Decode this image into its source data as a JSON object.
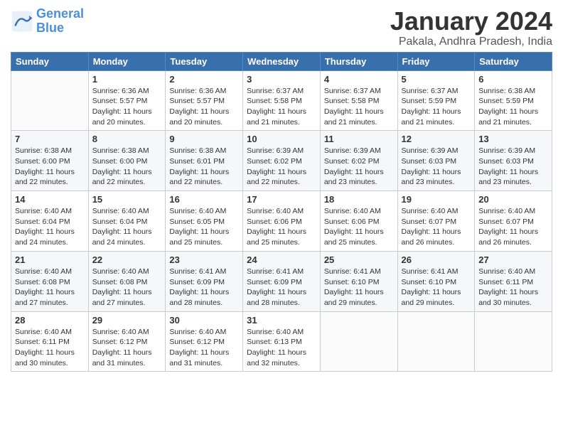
{
  "logo": {
    "text_general": "General",
    "text_blue": "Blue"
  },
  "header": {
    "title": "January 2024",
    "subtitle": "Pakala, Andhra Pradesh, India"
  },
  "weekdays": [
    "Sunday",
    "Monday",
    "Tuesday",
    "Wednesday",
    "Thursday",
    "Friday",
    "Saturday"
  ],
  "weeks": [
    [
      {
        "day": "",
        "info": ""
      },
      {
        "day": "1",
        "info": "Sunrise: 6:36 AM\nSunset: 5:57 PM\nDaylight: 11 hours\nand 20 minutes."
      },
      {
        "day": "2",
        "info": "Sunrise: 6:36 AM\nSunset: 5:57 PM\nDaylight: 11 hours\nand 20 minutes."
      },
      {
        "day": "3",
        "info": "Sunrise: 6:37 AM\nSunset: 5:58 PM\nDaylight: 11 hours\nand 21 minutes."
      },
      {
        "day": "4",
        "info": "Sunrise: 6:37 AM\nSunset: 5:58 PM\nDaylight: 11 hours\nand 21 minutes."
      },
      {
        "day": "5",
        "info": "Sunrise: 6:37 AM\nSunset: 5:59 PM\nDaylight: 11 hours\nand 21 minutes."
      },
      {
        "day": "6",
        "info": "Sunrise: 6:38 AM\nSunset: 5:59 PM\nDaylight: 11 hours\nand 21 minutes."
      }
    ],
    [
      {
        "day": "7",
        "info": "Sunrise: 6:38 AM\nSunset: 6:00 PM\nDaylight: 11 hours\nand 22 minutes."
      },
      {
        "day": "8",
        "info": "Sunrise: 6:38 AM\nSunset: 6:00 PM\nDaylight: 11 hours\nand 22 minutes."
      },
      {
        "day": "9",
        "info": "Sunrise: 6:38 AM\nSunset: 6:01 PM\nDaylight: 11 hours\nand 22 minutes."
      },
      {
        "day": "10",
        "info": "Sunrise: 6:39 AM\nSunset: 6:02 PM\nDaylight: 11 hours\nand 22 minutes."
      },
      {
        "day": "11",
        "info": "Sunrise: 6:39 AM\nSunset: 6:02 PM\nDaylight: 11 hours\nand 23 minutes."
      },
      {
        "day": "12",
        "info": "Sunrise: 6:39 AM\nSunset: 6:03 PM\nDaylight: 11 hours\nand 23 minutes."
      },
      {
        "day": "13",
        "info": "Sunrise: 6:39 AM\nSunset: 6:03 PM\nDaylight: 11 hours\nand 23 minutes."
      }
    ],
    [
      {
        "day": "14",
        "info": "Sunrise: 6:40 AM\nSunset: 6:04 PM\nDaylight: 11 hours\nand 24 minutes."
      },
      {
        "day": "15",
        "info": "Sunrise: 6:40 AM\nSunset: 6:04 PM\nDaylight: 11 hours\nand 24 minutes."
      },
      {
        "day": "16",
        "info": "Sunrise: 6:40 AM\nSunset: 6:05 PM\nDaylight: 11 hours\nand 25 minutes."
      },
      {
        "day": "17",
        "info": "Sunrise: 6:40 AM\nSunset: 6:06 PM\nDaylight: 11 hours\nand 25 minutes."
      },
      {
        "day": "18",
        "info": "Sunrise: 6:40 AM\nSunset: 6:06 PM\nDaylight: 11 hours\nand 25 minutes."
      },
      {
        "day": "19",
        "info": "Sunrise: 6:40 AM\nSunset: 6:07 PM\nDaylight: 11 hours\nand 26 minutes."
      },
      {
        "day": "20",
        "info": "Sunrise: 6:40 AM\nSunset: 6:07 PM\nDaylight: 11 hours\nand 26 minutes."
      }
    ],
    [
      {
        "day": "21",
        "info": "Sunrise: 6:40 AM\nSunset: 6:08 PM\nDaylight: 11 hours\nand 27 minutes."
      },
      {
        "day": "22",
        "info": "Sunrise: 6:40 AM\nSunset: 6:08 PM\nDaylight: 11 hours\nand 27 minutes."
      },
      {
        "day": "23",
        "info": "Sunrise: 6:41 AM\nSunset: 6:09 PM\nDaylight: 11 hours\nand 28 minutes."
      },
      {
        "day": "24",
        "info": "Sunrise: 6:41 AM\nSunset: 6:09 PM\nDaylight: 11 hours\nand 28 minutes."
      },
      {
        "day": "25",
        "info": "Sunrise: 6:41 AM\nSunset: 6:10 PM\nDaylight: 11 hours\nand 29 minutes."
      },
      {
        "day": "26",
        "info": "Sunrise: 6:41 AM\nSunset: 6:10 PM\nDaylight: 11 hours\nand 29 minutes."
      },
      {
        "day": "27",
        "info": "Sunrise: 6:40 AM\nSunset: 6:11 PM\nDaylight: 11 hours\nand 30 minutes."
      }
    ],
    [
      {
        "day": "28",
        "info": "Sunrise: 6:40 AM\nSunset: 6:11 PM\nDaylight: 11 hours\nand 30 minutes."
      },
      {
        "day": "29",
        "info": "Sunrise: 6:40 AM\nSunset: 6:12 PM\nDaylight: 11 hours\nand 31 minutes."
      },
      {
        "day": "30",
        "info": "Sunrise: 6:40 AM\nSunset: 6:12 PM\nDaylight: 11 hours\nand 31 minutes."
      },
      {
        "day": "31",
        "info": "Sunrise: 6:40 AM\nSunset: 6:13 PM\nDaylight: 11 hours\nand 32 minutes."
      },
      {
        "day": "",
        "info": ""
      },
      {
        "day": "",
        "info": ""
      },
      {
        "day": "",
        "info": ""
      }
    ]
  ]
}
